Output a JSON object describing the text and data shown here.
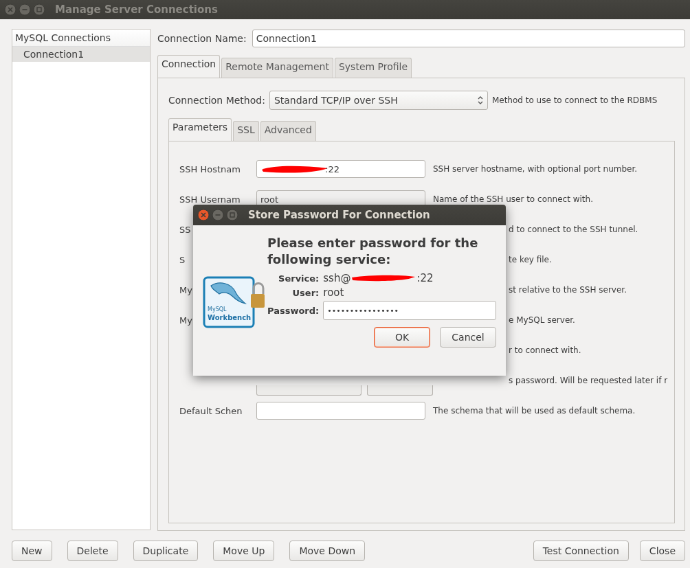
{
  "window": {
    "title": "Manage Server Connections",
    "active": false
  },
  "sidebar": {
    "header": "MySQL Connections",
    "items": [
      {
        "label": "Connection1",
        "selected": true
      }
    ]
  },
  "connection_name": {
    "label": "Connection Name:",
    "value": "Connection1"
  },
  "tabs": [
    {
      "label": "Connection",
      "selected": true
    },
    {
      "label": "Remote Management",
      "selected": false
    },
    {
      "label": "System Profile",
      "selected": false
    }
  ],
  "connection_method": {
    "label": "Connection Method:",
    "value": "Standard TCP/IP over SSH",
    "help": "Method to use to connect to the RDBMS"
  },
  "subtabs": [
    {
      "label": "Parameters",
      "selected": true
    },
    {
      "label": "SSL",
      "selected": false
    },
    {
      "label": "Advanced",
      "selected": false
    }
  ],
  "rows": [
    {
      "kind": "field",
      "label": "SSH Hostnam",
      "value": ":22",
      "redacted": true,
      "editable": true,
      "help": "SSH server hostname, with optional port number."
    },
    {
      "kind": "field",
      "label": "SSH Usernam",
      "value": "root",
      "redacted": false,
      "editable": false,
      "help": "Name of the SSH user to connect with."
    },
    {
      "kind": "covered",
      "label": "SS",
      "help": "d to connect to the SSH tunnel."
    },
    {
      "kind": "covered",
      "label": "S",
      "help": "te key file."
    },
    {
      "kind": "covered",
      "label": "My",
      "help": "st relative to the SSH server."
    },
    {
      "kind": "covered",
      "label": "My",
      "help": "e MySQL server."
    },
    {
      "kind": "covered",
      "label": "",
      "help": "r to connect with."
    },
    {
      "kind": "buttons",
      "help": "s password. Will be requested later if r"
    },
    {
      "kind": "field",
      "label": "Default Schen",
      "value": "",
      "redacted": false,
      "editable": true,
      "help": "The schema that will be used as default schema."
    }
  ],
  "buttons_left": [
    "New",
    "Delete",
    "Duplicate",
    "Move Up",
    "Move Down"
  ],
  "buttons_right": [
    "Test Connection",
    "Close"
  ],
  "dialog": {
    "title": "Store Password For Connection",
    "active": true,
    "heading": "Please enter password for the following service:",
    "logo_small": "MySQL",
    "logo_text": "Workbench",
    "service": {
      "label": "Service:",
      "prefix": "ssh@",
      "suffix": ":22",
      "redacted": true
    },
    "user": {
      "label": "User:",
      "value": "root"
    },
    "password": {
      "label": "Password:",
      "value": "••••••••••••••••"
    },
    "buttons": [
      {
        "label": "OK",
        "default": true
      },
      {
        "label": "Cancel",
        "default": false
      }
    ]
  }
}
